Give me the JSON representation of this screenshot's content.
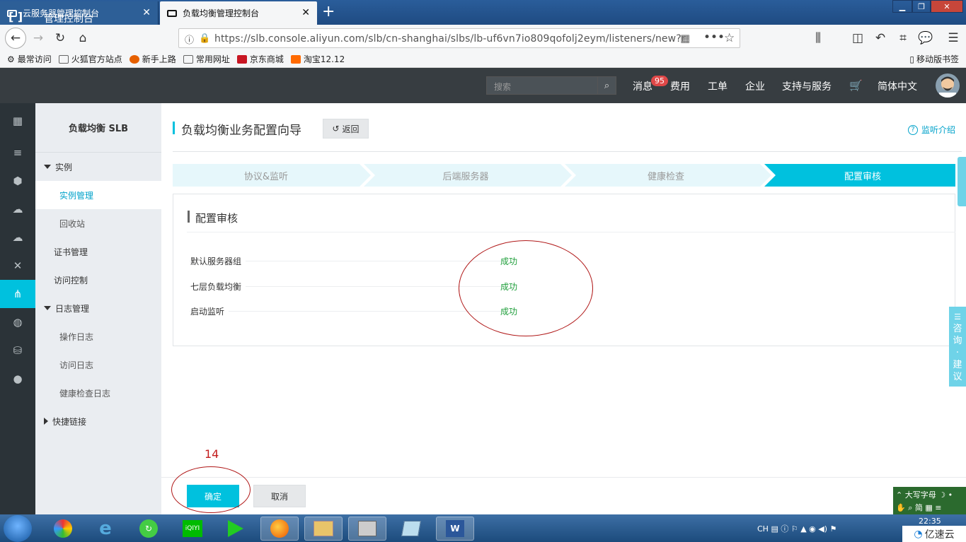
{
  "browser": {
    "tabs": [
      {
        "label": "云服务器管理控制台"
      },
      {
        "label": "负载均衡管理控制台"
      }
    ],
    "url": "https://slb.console.aliyun.com/slb/cn-shanghai/slbs/lb-uf6vn7io809qofolj2eym/listeners/new?r",
    "bookmarks": [
      "最常访问",
      "火狐官方站点",
      "新手上路",
      "常用网址",
      "京东商城",
      "淘宝12.12"
    ],
    "mobile_bookmarks": "移动版书签"
  },
  "header": {
    "console_title": "管理控制台",
    "search_placeholder": "搜索",
    "messages": "消息",
    "badge": "95",
    "fees": "费用",
    "tickets": "工单",
    "enterprise": "企业",
    "support": "支持与服务",
    "language": "简体中文"
  },
  "sidenav": {
    "title": "负载均衡 SLB",
    "instances_group": "实例",
    "instance_manage": "实例管理",
    "recycle": "回收站",
    "certs": "证书管理",
    "access_control": "访问控制",
    "log_group": "日志管理",
    "op_log": "操作日志",
    "access_log": "访问日志",
    "health_log": "健康检查日志",
    "quick_links": "快捷链接"
  },
  "main": {
    "title": "负载均衡业务配置向导",
    "back": "返回",
    "help": "监听介绍",
    "steps": [
      "协议&监听",
      "后端服务器",
      "健康检查",
      "配置审核"
    ],
    "active_step": 3,
    "card_title": "配置审核",
    "rows": [
      {
        "label": "默认服务器组",
        "status": "成功"
      },
      {
        "label": "七层负载均衡",
        "status": "成功"
      },
      {
        "label": "启动监听",
        "status": "成功"
      }
    ],
    "annotation": "14",
    "ok": "确定",
    "cancel": "取消"
  },
  "feedback": [
    "咨",
    "询",
    "·",
    "建",
    "议"
  ],
  "ime": {
    "line1": "大写字母",
    "line2": "简"
  },
  "taskbar": {
    "lang": "CH",
    "time": "22:35"
  },
  "watermark": "亿速云",
  "colors": {
    "accent": "#00c1de",
    "header": "#373d41",
    "rail": "#2b3338",
    "success": "#1e9e3a",
    "annotation": "#b01818"
  }
}
